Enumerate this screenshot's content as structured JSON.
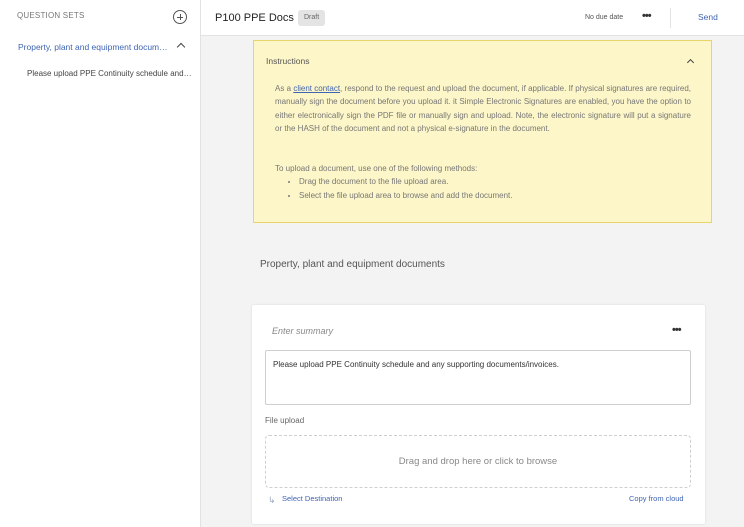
{
  "sidebar": {
    "heading": "QUESTION SETS",
    "section_label": "Property, plant and equipment documents",
    "item_label": "Please upload PPE Continuity schedule and any supporting documents/invoices."
  },
  "header": {
    "title": "P100 PPE Docs",
    "badge": "Draft",
    "due_date": "No due date",
    "more": "•••",
    "send_label": "Send"
  },
  "instructions": {
    "title": "Instructions",
    "para1_before_link": "As a ",
    "para1_link": "client contact",
    "para1_after_link": ", respond to the request and upload the document, if applicable. If physical signatures are required, manually sign the document before you upload it. it Simple Electronic Signatures are enabled, you have the option to either electronically sign the PDF file or manually sign and upload. Note, the electronic signature will put a signature or the HASH of the document and not a physical e-signature in the document.",
    "para2_intro": "To upload a document, use one of the following methods:",
    "methods": [
      "Drag the document to the file upload area.",
      "Select the file upload area to browse and add the document."
    ]
  },
  "section_title": "Property, plant and equipment documents",
  "card": {
    "summary_placeholder": "Enter summary",
    "more": "•••",
    "description": "Please upload PPE Continuity schedule and any supporting documents/invoices.",
    "upload_label": "File upload",
    "dropzone_text": "Drag and drop here or click to browse",
    "select_destination": "Select Destination",
    "copy_from_cloud": "Copy from cloud"
  },
  "colors": {
    "accent": "#3f64b3",
    "instructions_bg": "#fdf6c8",
    "instructions_border": "#e9d46a",
    "page_bg": "#f3f3f3"
  }
}
